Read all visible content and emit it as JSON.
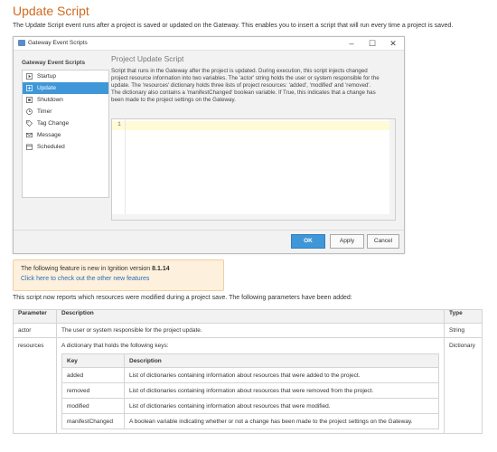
{
  "page": {
    "title": "Update Script",
    "intro": "The Update Script event runs after a project is saved or updated on the Gateway. This enables you to insert a script that will run every time a project is saved."
  },
  "dialog": {
    "title": "Gateway Event Scripts",
    "sidebar_header": "Gateway Event Scripts",
    "items": [
      {
        "label": "Startup",
        "icon": "startup-icon"
      },
      {
        "label": "Update",
        "icon": "update-icon",
        "selected": true
      },
      {
        "label": "Shutdown",
        "icon": "shutdown-icon"
      },
      {
        "label": "Timer",
        "icon": "timer-icon"
      },
      {
        "label": "Tag Change",
        "icon": "tag-icon"
      },
      {
        "label": "Message",
        "icon": "message-icon"
      },
      {
        "label": "Scheduled",
        "icon": "calendar-icon"
      }
    ],
    "panel_title": "Project Update Script",
    "description": [
      "Script that runs in the Gateway after the project is updated. During execution, this script injects changed",
      "project resource information into two variables. The 'actor' string holds the user or system responsible for the",
      "update. The 'resources' dictionary holds three lists of project resources: 'added', 'modified' and 'removed'.",
      "The dictionary also contains a 'manifestChanged' boolean variable. If True, this indicates that a change has",
      "been made to the project settings on the Gateway."
    ],
    "editor_line_number": "1",
    "buttons": {
      "ok": "OK",
      "apply": "Apply",
      "cancel": "Cancel"
    }
  },
  "info": {
    "text": "The following feature is new in Ignition version",
    "version": "8.1.14",
    "link": "Click here to check out the other new features"
  },
  "paragraph": "This script now reports which resources were modified during a project save. The following parameters have been added:",
  "params_table": {
    "headers": [
      "Parameter",
      "Description",
      "Type"
    ],
    "rows": [
      {
        "param": "actor",
        "desc": "The user or system responsible for the project update.",
        "type": "String"
      },
      {
        "param": "resources",
        "desc": "A dictionary that holds the following keys:",
        "type": "Dictionary"
      }
    ],
    "keys_headers": [
      "Key",
      "Description"
    ],
    "keys": [
      {
        "key": "added",
        "desc": "List of dictionaries containing information about resources that were added to the project."
      },
      {
        "key": "removed",
        "desc": "List of dictionaries containing information about resources that were removed from the project."
      },
      {
        "key": "modified",
        "desc": "List of dictionaries containing information about resources that were modified."
      },
      {
        "key": "manifestChanged",
        "desc": "A boolean variable indicating whether or not a change has been made to the project settings on the Gateway."
      }
    ]
  }
}
